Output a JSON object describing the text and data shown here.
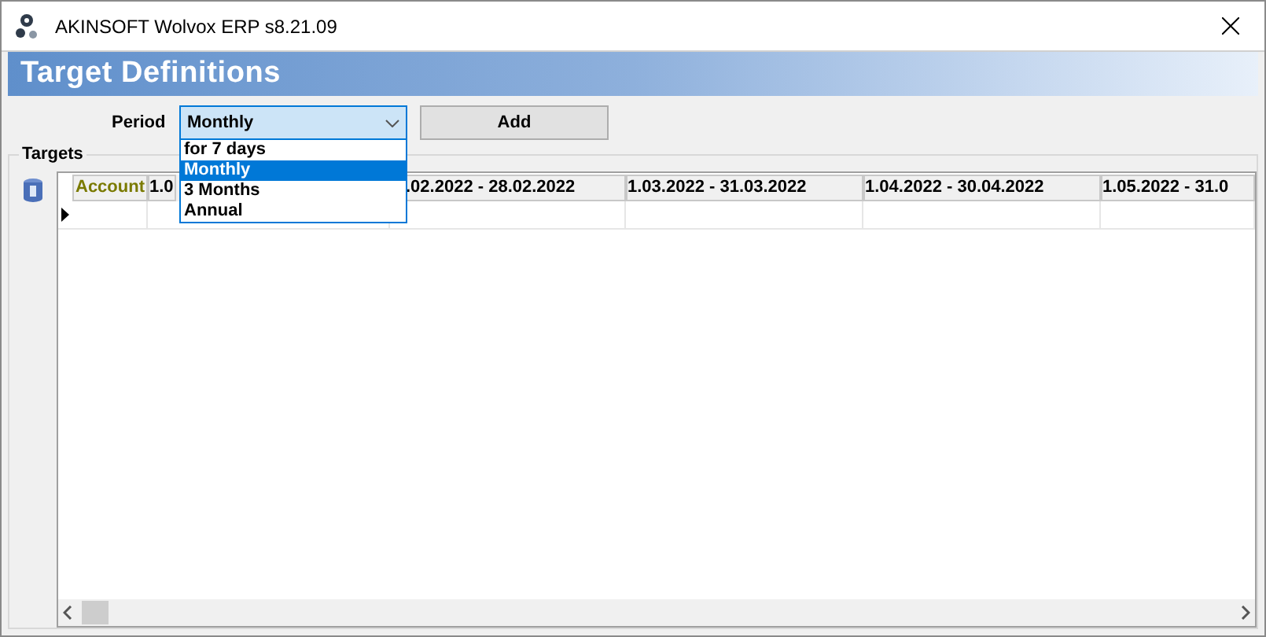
{
  "window": {
    "title": "AKINSOFT Wolvox ERP s8.21.09"
  },
  "header": {
    "title": "Target Definitions"
  },
  "period": {
    "label": "Period",
    "value": "Monthly",
    "expanded": true,
    "options": [
      {
        "label": "for 7 days",
        "selected": false
      },
      {
        "label": "Monthly",
        "selected": true
      },
      {
        "label": "3 Months",
        "selected": false
      },
      {
        "label": "Annual",
        "selected": false
      }
    ]
  },
  "add_button": "Add",
  "targets": {
    "title": "Targets",
    "columns": [
      {
        "label": "Account",
        "kind": "key"
      },
      {
        "label": "1.0",
        "kind": "period"
      },
      {
        "label": ".02.2022 - 28.02.2022",
        "kind": "period"
      },
      {
        "label": "1.03.2022 - 31.03.2022",
        "kind": "period"
      },
      {
        "label": "1.04.2022 - 30.04.2022",
        "kind": "period"
      },
      {
        "label": "1.05.2022 - 31.0",
        "kind": "period"
      }
    ]
  }
}
